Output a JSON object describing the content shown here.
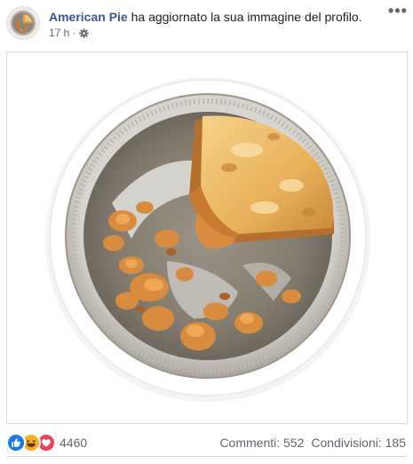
{
  "post": {
    "page_name": "American Pie",
    "action_text": "ha aggiornato la sua immagine del profilo.",
    "timestamp": "17 h",
    "separator": "·",
    "audience_icon": "public-gear-icon",
    "more_label": "•••"
  },
  "image": {
    "subject": "apple-pie-in-foil-tin-icon",
    "background_color": "#ffffff"
  },
  "footer": {
    "reactions": [
      "like-icon",
      "haha-icon",
      "love-icon"
    ],
    "reaction_count": "4460",
    "comments_label": "Commenti: 552",
    "shares_label": "Condivisioni: 185"
  },
  "colors": {
    "link": "#385898",
    "secondary_text": "#606770",
    "like_blue": "#1877f2",
    "love_red": "#f33e58",
    "haha_yellow": "#f7b125"
  }
}
